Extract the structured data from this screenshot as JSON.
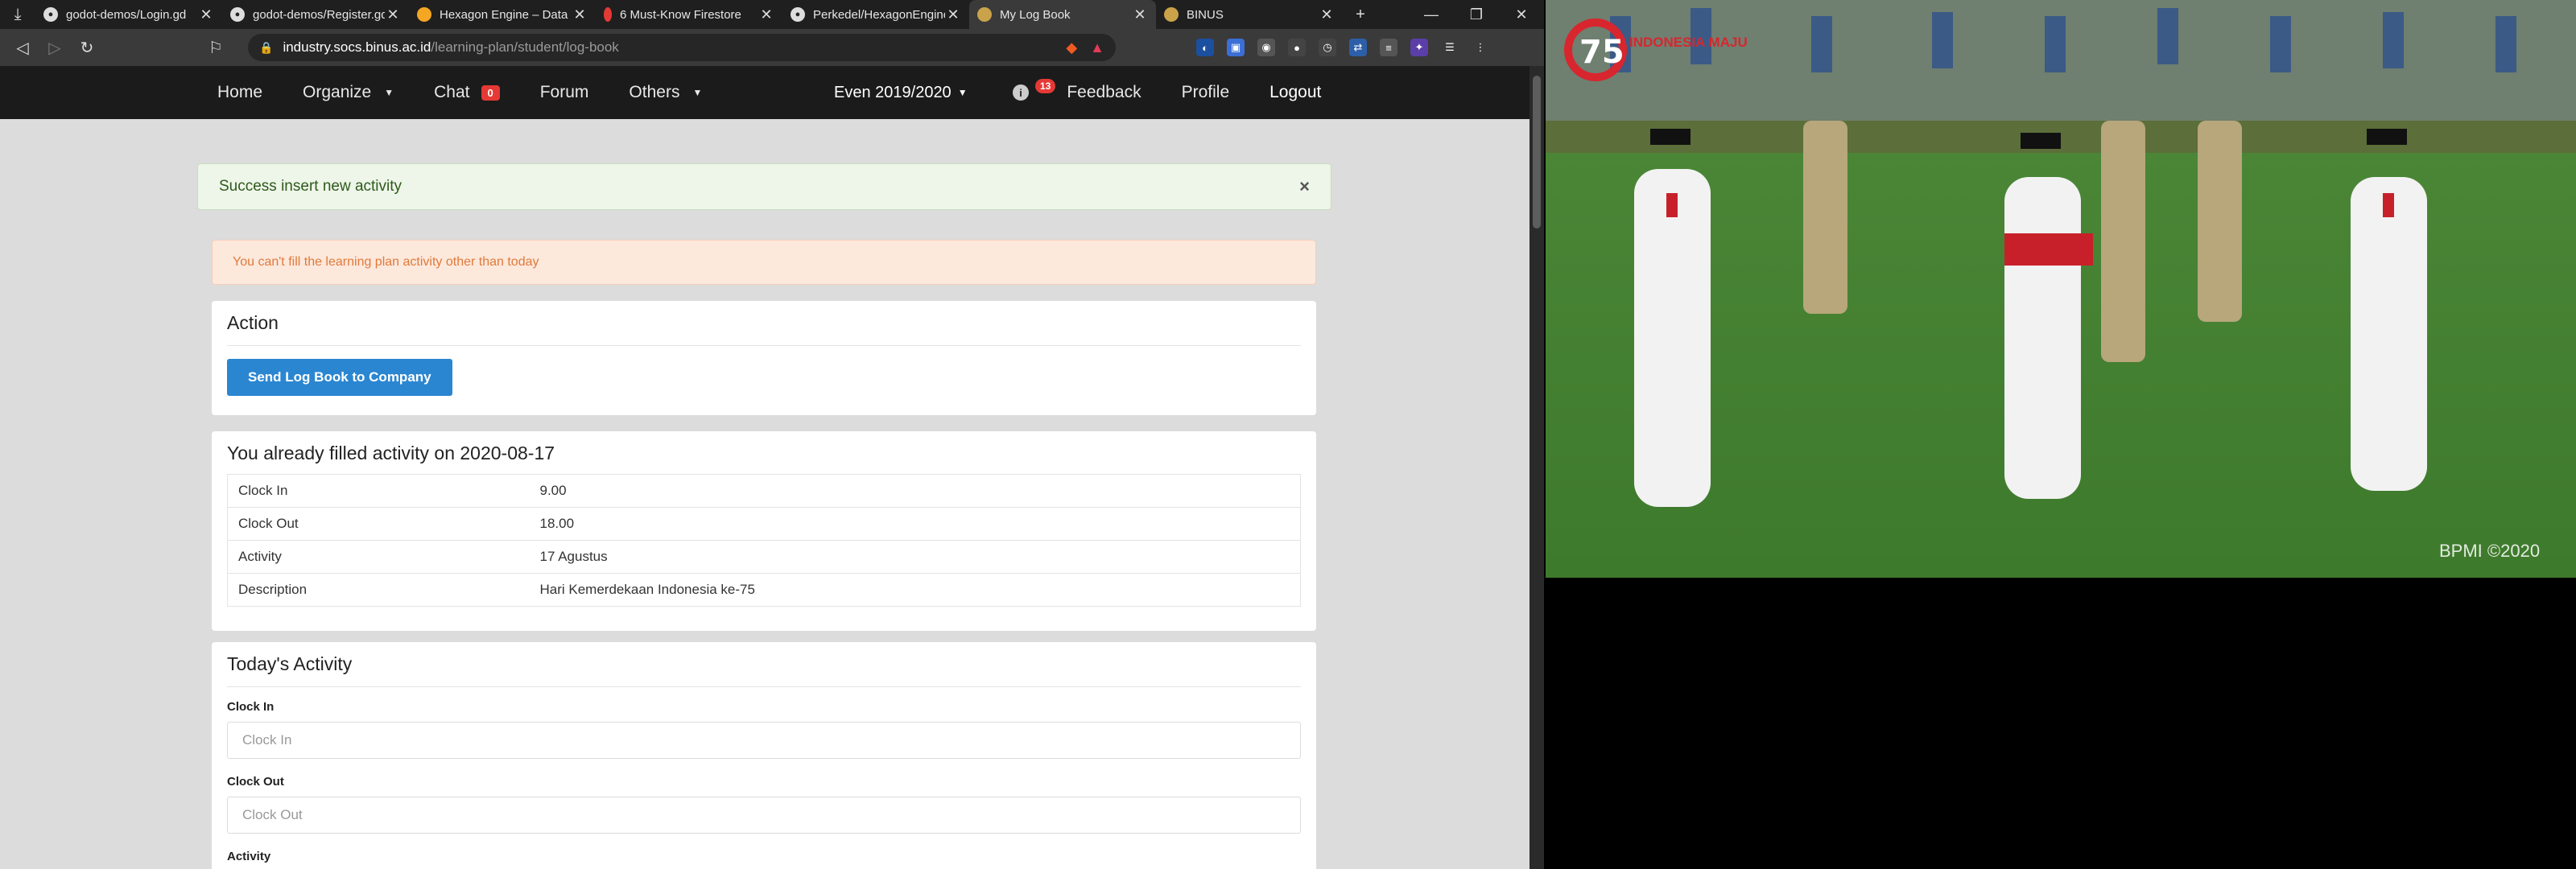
{
  "tabs": [
    {
      "label": "godot-demos/Login.gd",
      "icon": "github-icon",
      "active": false
    },
    {
      "label": "godot-demos/Register.gd",
      "icon": "github-icon",
      "active": false
    },
    {
      "label": "Hexagon Engine – Data",
      "icon": "firebase-icon",
      "active": false
    },
    {
      "label": "6 Must-Know Firestore",
      "icon": "fire-icon",
      "active": false
    },
    {
      "label": "Perkedel/HexagonEngine",
      "icon": "github-icon",
      "active": false
    },
    {
      "label": "My Log Book",
      "icon": "binus-icon",
      "active": true
    },
    {
      "label": "BINUS",
      "icon": "binus-icon",
      "active": false
    }
  ],
  "address": {
    "host": "industry.socs.binus.ac.id",
    "path": "/learning-plan/student/log-book"
  },
  "sitenav": {
    "home": "Home",
    "organize": "Organize",
    "chat": "Chat",
    "chat_badge": "0",
    "forum": "Forum",
    "others": "Others",
    "term": "Even 2019/2020",
    "notif_count": "13",
    "feedback": "Feedback",
    "profile": "Profile",
    "logout": "Logout"
  },
  "alerts": {
    "success": "Success insert new activity",
    "warning": "You can't fill the learning plan activity other than today"
  },
  "action_card": {
    "title": "Action",
    "button": "Send Log Book to Company"
  },
  "filled_card": {
    "title": "You already filled activity on 2020-08-17",
    "rows": [
      {
        "label": "Clock In",
        "value": "9.00"
      },
      {
        "label": "Clock Out",
        "value": "18.00"
      },
      {
        "label": "Activity",
        "value": "17 Agustus"
      },
      {
        "label": "Description",
        "value": "Hari Kemerdekaan Indonesia ke-75"
      }
    ]
  },
  "today_card": {
    "title": "Today's Activity",
    "clock_in_label": "Clock In",
    "clock_in_placeholder": "Clock In",
    "clock_out_label": "Clock Out",
    "clock_out_placeholder": "Clock Out",
    "activity_label": "Activity"
  },
  "video": {
    "logo_text": "INDONESIA MAJU",
    "watermark": "BPMI ©2020"
  },
  "colors": {
    "primary": "#2b86d1",
    "badge": "#e53935",
    "nav_bg": "#1b1b1b"
  }
}
